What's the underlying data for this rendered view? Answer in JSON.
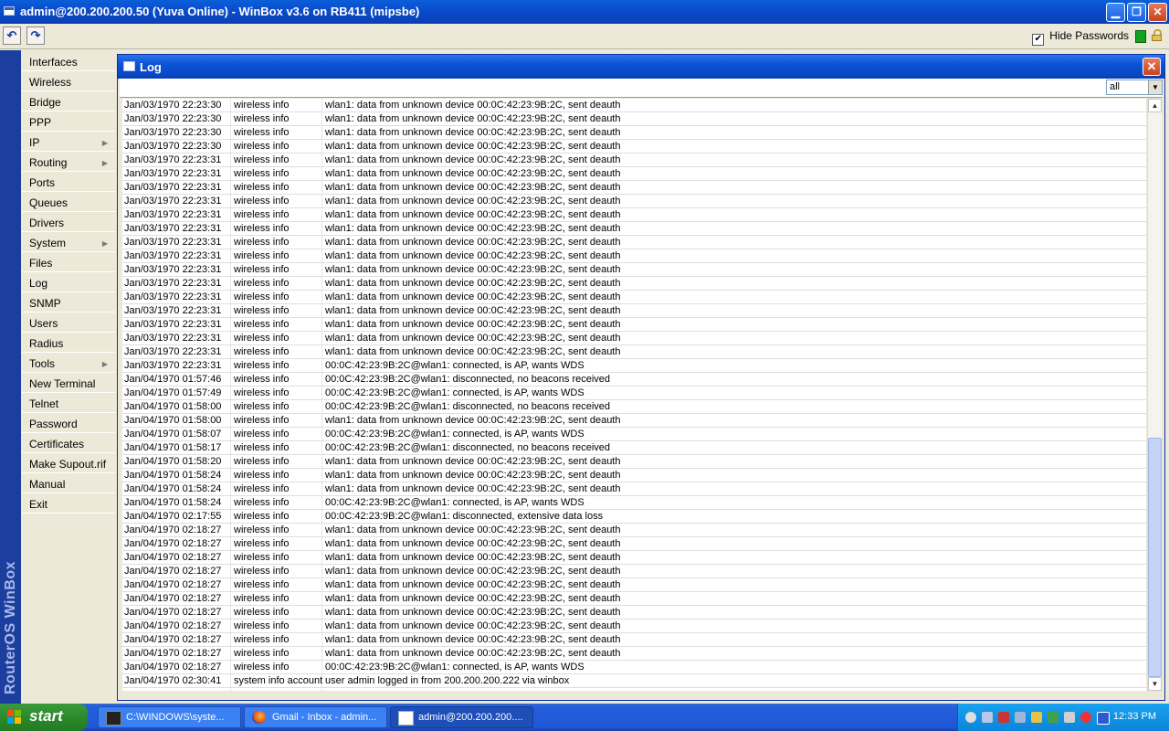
{
  "window": {
    "title": "admin@200.200.200.50 (Yuva Online) - WinBox v3.6 on RB411 (mipsbe)",
    "min": "▁",
    "max": "❐",
    "close": "✕"
  },
  "toolbar": {
    "undo": "↶",
    "redo": "↷",
    "hide_passwords_label": "Hide Passwords",
    "hide_passwords_checked": "✔"
  },
  "brand": "RouterOS WinBox",
  "sidebar": {
    "items": [
      {
        "label": "Interfaces",
        "arrow": ""
      },
      {
        "label": "Wireless",
        "arrow": ""
      },
      {
        "label": "Bridge",
        "arrow": ""
      },
      {
        "label": "PPP",
        "arrow": ""
      },
      {
        "label": "IP",
        "arrow": "▶"
      },
      {
        "label": "Routing",
        "arrow": "▶"
      },
      {
        "label": "Ports",
        "arrow": ""
      },
      {
        "label": "Queues",
        "arrow": ""
      },
      {
        "label": "Drivers",
        "arrow": ""
      },
      {
        "label": "System",
        "arrow": "▶"
      },
      {
        "label": "Files",
        "arrow": ""
      },
      {
        "label": "Log",
        "arrow": ""
      },
      {
        "label": "SNMP",
        "arrow": ""
      },
      {
        "label": "Users",
        "arrow": ""
      },
      {
        "label": "Radius",
        "arrow": ""
      },
      {
        "label": "Tools",
        "arrow": "▶"
      },
      {
        "label": "New Terminal",
        "arrow": ""
      },
      {
        "label": "Telnet",
        "arrow": ""
      },
      {
        "label": "Password",
        "arrow": ""
      },
      {
        "label": "Certificates",
        "arrow": ""
      },
      {
        "label": "Make Supout.rif",
        "arrow": ""
      },
      {
        "label": "Manual",
        "arrow": ""
      },
      {
        "label": "Exit",
        "arrow": ""
      }
    ]
  },
  "log_window": {
    "title": "Log",
    "close": "✕",
    "filter_value": "all",
    "filter_arrow": "▼",
    "scroll_up": "▲",
    "scroll_down": "▼",
    "rows": [
      {
        "time": "Jan/03/1970 22:23:30",
        "topic": "wireless info",
        "msg": "wlan1: data from unknown device 00:0C:42:23:9B:2C, sent deauth"
      },
      {
        "time": "Jan/03/1970 22:23:30",
        "topic": "wireless info",
        "msg": "wlan1: data from unknown device 00:0C:42:23:9B:2C, sent deauth"
      },
      {
        "time": "Jan/03/1970 22:23:30",
        "topic": "wireless info",
        "msg": "wlan1: data from unknown device 00:0C:42:23:9B:2C, sent deauth"
      },
      {
        "time": "Jan/03/1970 22:23:30",
        "topic": "wireless info",
        "msg": "wlan1: data from unknown device 00:0C:42:23:9B:2C, sent deauth"
      },
      {
        "time": "Jan/03/1970 22:23:31",
        "topic": "wireless info",
        "msg": "wlan1: data from unknown device 00:0C:42:23:9B:2C, sent deauth"
      },
      {
        "time": "Jan/03/1970 22:23:31",
        "topic": "wireless info",
        "msg": "wlan1: data from unknown device 00:0C:42:23:9B:2C, sent deauth"
      },
      {
        "time": "Jan/03/1970 22:23:31",
        "topic": "wireless info",
        "msg": "wlan1: data from unknown device 00:0C:42:23:9B:2C, sent deauth"
      },
      {
        "time": "Jan/03/1970 22:23:31",
        "topic": "wireless info",
        "msg": "wlan1: data from unknown device 00:0C:42:23:9B:2C, sent deauth"
      },
      {
        "time": "Jan/03/1970 22:23:31",
        "topic": "wireless info",
        "msg": "wlan1: data from unknown device 00:0C:42:23:9B:2C, sent deauth"
      },
      {
        "time": "Jan/03/1970 22:23:31",
        "topic": "wireless info",
        "msg": "wlan1: data from unknown device 00:0C:42:23:9B:2C, sent deauth"
      },
      {
        "time": "Jan/03/1970 22:23:31",
        "topic": "wireless info",
        "msg": "wlan1: data from unknown device 00:0C:42:23:9B:2C, sent deauth"
      },
      {
        "time": "Jan/03/1970 22:23:31",
        "topic": "wireless info",
        "msg": "wlan1: data from unknown device 00:0C:42:23:9B:2C, sent deauth"
      },
      {
        "time": "Jan/03/1970 22:23:31",
        "topic": "wireless info",
        "msg": "wlan1: data from unknown device 00:0C:42:23:9B:2C, sent deauth"
      },
      {
        "time": "Jan/03/1970 22:23:31",
        "topic": "wireless info",
        "msg": "wlan1: data from unknown device 00:0C:42:23:9B:2C, sent deauth"
      },
      {
        "time": "Jan/03/1970 22:23:31",
        "topic": "wireless info",
        "msg": "wlan1: data from unknown device 00:0C:42:23:9B:2C, sent deauth"
      },
      {
        "time": "Jan/03/1970 22:23:31",
        "topic": "wireless info",
        "msg": "wlan1: data from unknown device 00:0C:42:23:9B:2C, sent deauth"
      },
      {
        "time": "Jan/03/1970 22:23:31",
        "topic": "wireless info",
        "msg": "wlan1: data from unknown device 00:0C:42:23:9B:2C, sent deauth"
      },
      {
        "time": "Jan/03/1970 22:23:31",
        "topic": "wireless info",
        "msg": "wlan1: data from unknown device 00:0C:42:23:9B:2C, sent deauth"
      },
      {
        "time": "Jan/03/1970 22:23:31",
        "topic": "wireless info",
        "msg": "wlan1: data from unknown device 00:0C:42:23:9B:2C, sent deauth"
      },
      {
        "time": "Jan/03/1970 22:23:31",
        "topic": "wireless info",
        "msg": "00:0C:42:23:9B:2C@wlan1: connected, is AP, wants WDS"
      },
      {
        "time": "Jan/04/1970 01:57:46",
        "topic": "wireless info",
        "msg": "00:0C:42:23:9B:2C@wlan1: disconnected, no beacons received"
      },
      {
        "time": "Jan/04/1970 01:57:49",
        "topic": "wireless info",
        "msg": "00:0C:42:23:9B:2C@wlan1: connected, is AP, wants WDS"
      },
      {
        "time": "Jan/04/1970 01:58:00",
        "topic": "wireless info",
        "msg": "00:0C:42:23:9B:2C@wlan1: disconnected, no beacons received"
      },
      {
        "time": "Jan/04/1970 01:58:00",
        "topic": "wireless info",
        "msg": "wlan1: data from unknown device 00:0C:42:23:9B:2C, sent deauth"
      },
      {
        "time": "Jan/04/1970 01:58:07",
        "topic": "wireless info",
        "msg": "00:0C:42:23:9B:2C@wlan1: connected, is AP, wants WDS"
      },
      {
        "time": "Jan/04/1970 01:58:17",
        "topic": "wireless info",
        "msg": "00:0C:42:23:9B:2C@wlan1: disconnected, no beacons received"
      },
      {
        "time": "Jan/04/1970 01:58:20",
        "topic": "wireless info",
        "msg": "wlan1: data from unknown device 00:0C:42:23:9B:2C, sent deauth"
      },
      {
        "time": "Jan/04/1970 01:58:24",
        "topic": "wireless info",
        "msg": "wlan1: data from unknown device 00:0C:42:23:9B:2C, sent deauth"
      },
      {
        "time": "Jan/04/1970 01:58:24",
        "topic": "wireless info",
        "msg": "wlan1: data from unknown device 00:0C:42:23:9B:2C, sent deauth"
      },
      {
        "time": "Jan/04/1970 01:58:24",
        "topic": "wireless info",
        "msg": "00:0C:42:23:9B:2C@wlan1: connected, is AP, wants WDS"
      },
      {
        "time": "Jan/04/1970 02:17:55",
        "topic": "wireless info",
        "msg": "00:0C:42:23:9B:2C@wlan1: disconnected, extensive data loss"
      },
      {
        "time": "Jan/04/1970 02:18:27",
        "topic": "wireless info",
        "msg": "wlan1: data from unknown device 00:0C:42:23:9B:2C, sent deauth"
      },
      {
        "time": "Jan/04/1970 02:18:27",
        "topic": "wireless info",
        "msg": "wlan1: data from unknown device 00:0C:42:23:9B:2C, sent deauth"
      },
      {
        "time": "Jan/04/1970 02:18:27",
        "topic": "wireless info",
        "msg": "wlan1: data from unknown device 00:0C:42:23:9B:2C, sent deauth"
      },
      {
        "time": "Jan/04/1970 02:18:27",
        "topic": "wireless info",
        "msg": "wlan1: data from unknown device 00:0C:42:23:9B:2C, sent deauth"
      },
      {
        "time": "Jan/04/1970 02:18:27",
        "topic": "wireless info",
        "msg": "wlan1: data from unknown device 00:0C:42:23:9B:2C, sent deauth"
      },
      {
        "time": "Jan/04/1970 02:18:27",
        "topic": "wireless info",
        "msg": "wlan1: data from unknown device 00:0C:42:23:9B:2C, sent deauth"
      },
      {
        "time": "Jan/04/1970 02:18:27",
        "topic": "wireless info",
        "msg": "wlan1: data from unknown device 00:0C:42:23:9B:2C, sent deauth"
      },
      {
        "time": "Jan/04/1970 02:18:27",
        "topic": "wireless info",
        "msg": "wlan1: data from unknown device 00:0C:42:23:9B:2C, sent deauth"
      },
      {
        "time": "Jan/04/1970 02:18:27",
        "topic": "wireless info",
        "msg": "wlan1: data from unknown device 00:0C:42:23:9B:2C, sent deauth"
      },
      {
        "time": "Jan/04/1970 02:18:27",
        "topic": "wireless info",
        "msg": "wlan1: data from unknown device 00:0C:42:23:9B:2C, sent deauth"
      },
      {
        "time": "Jan/04/1970 02:18:27",
        "topic": "wireless info",
        "msg": "00:0C:42:23:9B:2C@wlan1: connected, is AP, wants WDS"
      },
      {
        "time": "Jan/04/1970 02:30:41",
        "topic": "system info account",
        "msg": "user admin logged in from 200.200.200.222 via winbox"
      }
    ]
  },
  "taskbar": {
    "start_label": "start",
    "buttons": [
      {
        "label": "C:\\WINDOWS\\syste...",
        "icon": "cmd-icon"
      },
      {
        "label": "Gmail - Inbox - admin...",
        "icon": "firefox-icon"
      },
      {
        "label": "admin@200.200.200....",
        "icon": "winbox-icon"
      }
    ],
    "clock": "12:33 PM"
  },
  "colors": {
    "xp_blue": "#0a4fd0",
    "sidebar_bg": "#ece9d8",
    "brand_band": "#1c3f9f",
    "start_green": "#2b8a2b"
  }
}
